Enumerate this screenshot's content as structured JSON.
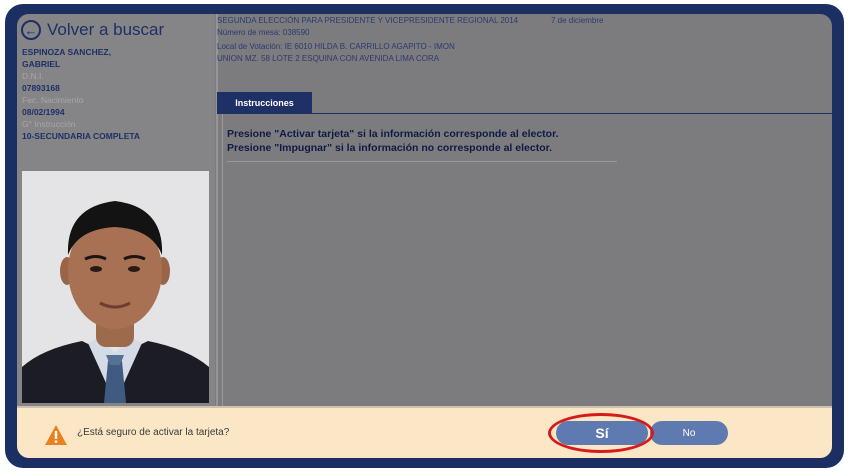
{
  "back": {
    "label": "Volver a buscar"
  },
  "elector": {
    "name_line1": "ESPINOZA SANCHEZ,",
    "name_line2": "GABRIEL",
    "dni_label": "D.N.I.",
    "dni": "07893168",
    "birth_label": "Fec. Nacimiento",
    "birth": "08/02/1994",
    "education_label": "G° Instrucción",
    "education": "10-SECUNDARIA COMPLETA"
  },
  "header": {
    "election": "SEGUNDA ELECCIÓN PARA PRESIDENTE Y VICEPRESIDENTE REGIONAL 2014",
    "date": "7 de diciembre",
    "table": "Número de mesa: 038590",
    "location_line1": "Local de Votación: IE 6010 HILDA B. CARRILLO AGAPITO - IMON",
    "location_line2": "UNION MZ. 58 LOTE 2 ESQUINA CON AVENIDA LIMA CORA"
  },
  "tab": {
    "label": "Instrucciones"
  },
  "instructions": [
    "Presione \"Activar tarjeta\" si la información corresponde al elector.",
    "Presione \"Impugnar\" si la información no corresponde al elector."
  ],
  "confirm": {
    "question": "¿Está seguro de activar la tarjeta?",
    "yes_label": "Sí",
    "no_label": "No"
  },
  "colors": {
    "frame": "#1c2f63",
    "screen": "#7c7c7f",
    "tab": "#1f3066",
    "bar": "#fbe7c6",
    "button": "#5e7ab0",
    "highlight": "#d71a1a",
    "warning": "#e9811f"
  },
  "icons": {
    "back": "arrow-left-circle-icon",
    "warning": "warning-triangle-icon"
  }
}
